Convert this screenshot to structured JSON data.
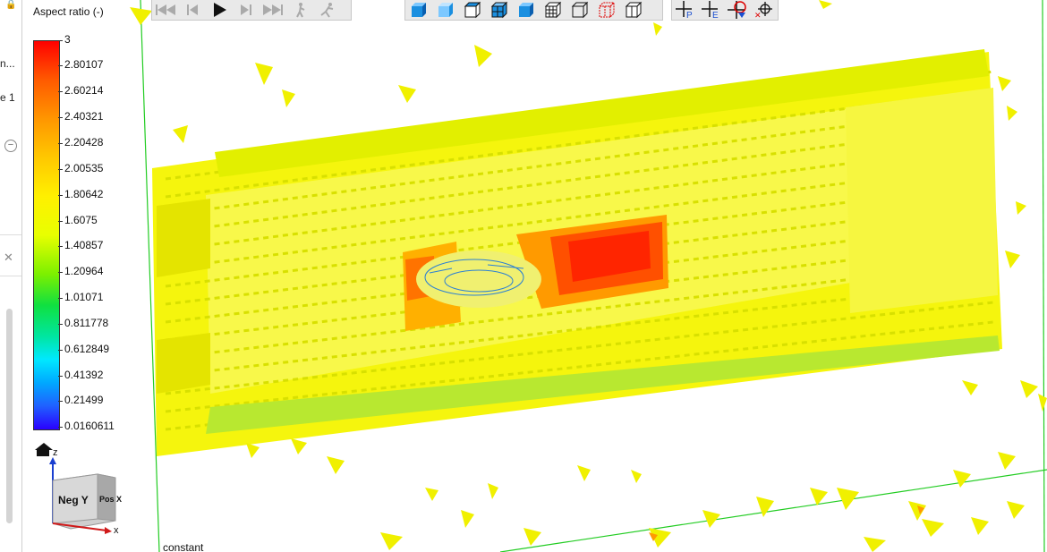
{
  "left_panel": {
    "text_1": "n...",
    "text_2": "e 1"
  },
  "legend": {
    "title": "Aspect ratio (-)",
    "ticks": [
      "3",
      "2.80107",
      "2.60214",
      "2.40321",
      "2.20428",
      "2.00535",
      "1.80642",
      "1.6075",
      "1.40857",
      "1.20964",
      "1.01071",
      "0.811778",
      "0.612849",
      "0.41392",
      "0.21499",
      "0.0160611"
    ]
  },
  "toolbar_playback": {
    "buttons": [
      "skip-to-start",
      "step-back",
      "play",
      "step-forward",
      "skip-to-end",
      "walk",
      "run"
    ]
  },
  "toolbar_views": {
    "buttons": [
      "view-cube-front",
      "view-cube-side",
      "view-cube-top",
      "view-cube-iso",
      "view-cube-blue",
      "wireframe-cube",
      "outline-cube",
      "red-dashed-cube",
      "transparent-cube"
    ]
  },
  "toolbar_probe": {
    "buttons": [
      "probe-point",
      "probe-element",
      "probe-grab",
      "probe-clear"
    ],
    "labels": {
      "p": "P",
      "e": "E"
    }
  },
  "axis_widget": {
    "front_label": "Neg Y",
    "side_label": "Pos X",
    "z_label": "z",
    "x_label": "x"
  },
  "status": {
    "label": "constant"
  },
  "colors": {
    "mesh_yellow": "#f2f200",
    "mesh_green": "#a8e61e",
    "mesh_orange": "#ff9a00",
    "mesh_red": "#ff1a00",
    "mesh_blue": "#2a7fd4",
    "domain_green": "#22cc22"
  }
}
